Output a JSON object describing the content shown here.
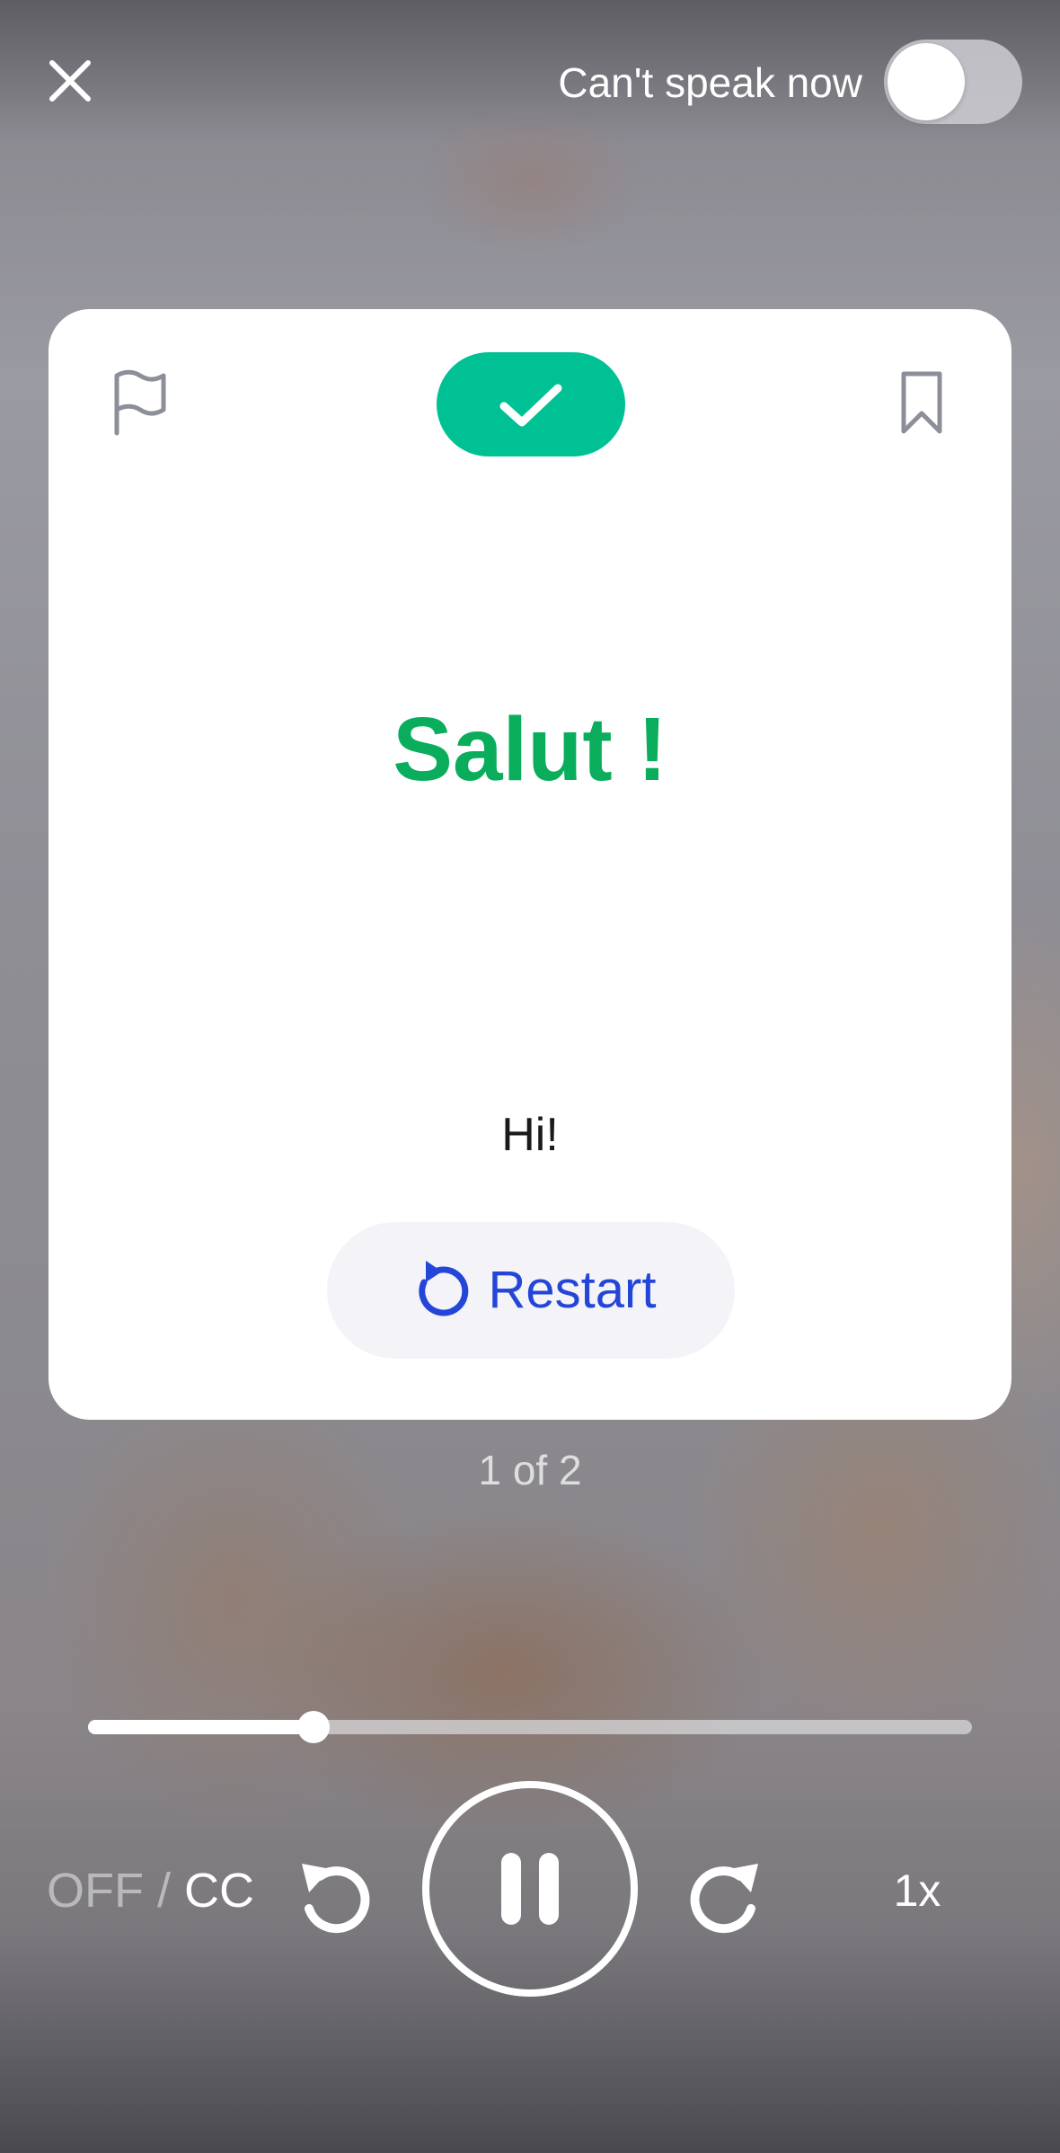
{
  "header": {
    "close_icon": "close-icon",
    "speak_toggle_label": "Can't speak now",
    "speak_toggle_on": false
  },
  "card": {
    "flag_icon": "flag-icon",
    "bookmark_icon": "bookmark-icon",
    "status_icon": "checkmark-icon",
    "status_color": "#00c193",
    "phrase": "Salut !",
    "phrase_color": "#0aad5b",
    "translation": "Hi!",
    "restart_label": "Restart",
    "restart_icon": "restart-icon",
    "restart_color": "#2446d8"
  },
  "counter": "1 of 2",
  "player": {
    "progress": 0.255,
    "captions_off_label": "OFF",
    "captions_separator": "/",
    "captions_on_label": "CC",
    "rewind_icon": "rewind-icon",
    "pause_icon": "pause-icon",
    "forward_icon": "forward-icon",
    "speed_label": "1x"
  }
}
